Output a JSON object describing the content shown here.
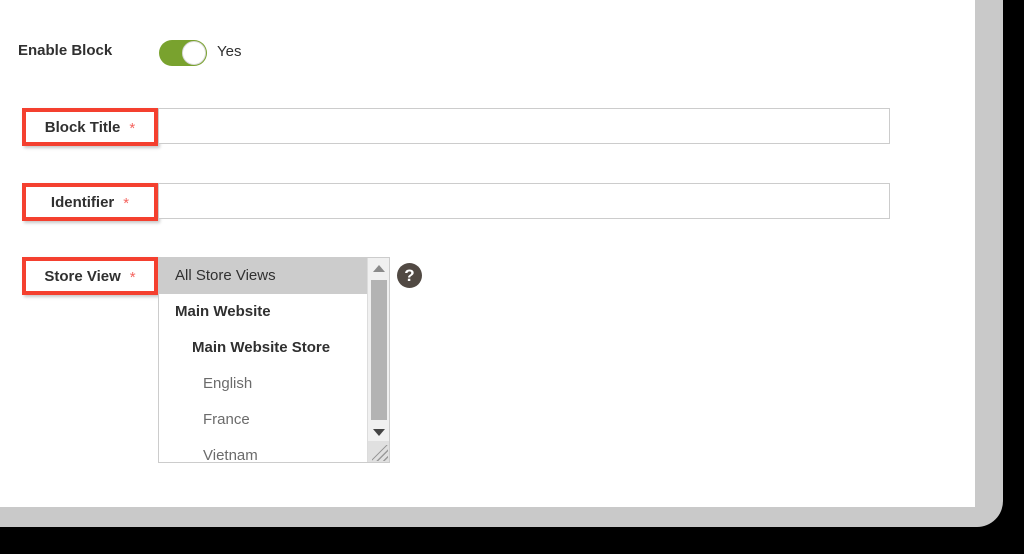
{
  "form": {
    "enable_block": {
      "label": "Enable Block",
      "toggle_state": "on",
      "value_text": "Yes"
    },
    "block_title": {
      "label": "Block Title",
      "required_marker": "*",
      "value": "",
      "placeholder": ""
    },
    "identifier": {
      "label": "Identifier",
      "required_marker": "*",
      "value": "",
      "placeholder": ""
    },
    "store_view": {
      "label": "Store View",
      "required_marker": "*",
      "help_icon": "help-question-icon",
      "options": [
        {
          "label": "All Store Views",
          "level": 0,
          "selected": true
        },
        {
          "label": "Main Website",
          "level": 1,
          "selected": false
        },
        {
          "label": "Main Website Store",
          "level": 2,
          "selected": false
        },
        {
          "label": "English",
          "level": 3,
          "selected": false
        },
        {
          "label": "France",
          "level": 3,
          "selected": false
        },
        {
          "label": "Vietnam",
          "level": 3,
          "selected": false
        }
      ],
      "scrollbar": {
        "up_arrow_icon": "triangle-up-icon",
        "down_arrow_icon": "triangle-down-icon",
        "resize_grip_icon": "resize-grip-icon"
      }
    }
  },
  "colors": {
    "highlight_border": "#f4402f",
    "required_star": "#f4645f",
    "toggle_on": "#79a22e",
    "selected_row": "#cccccc",
    "help_icon_bg": "#514943",
    "input_border": "#cccccc",
    "text": "#303030",
    "muted_text": "#6b6b6b",
    "card_frame": "#c9c9c9",
    "page_background": "#000000"
  }
}
